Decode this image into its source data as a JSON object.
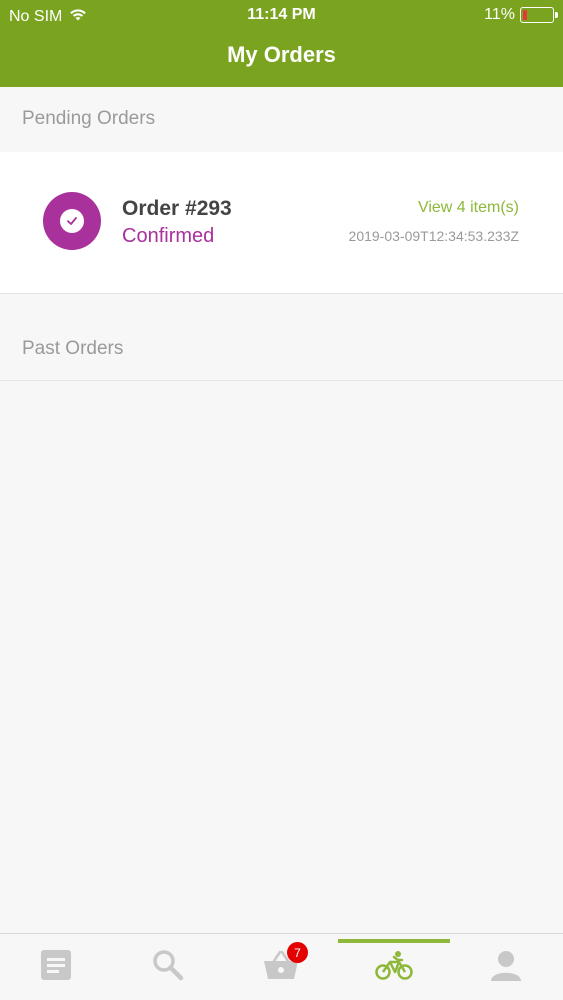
{
  "status_bar": {
    "carrier": "No SIM",
    "time": "11:14 PM",
    "battery": "11%"
  },
  "header": {
    "title": "My Orders"
  },
  "sections": {
    "pending_label": "Pending Orders",
    "past_label": "Past Orders"
  },
  "pending_orders": [
    {
      "number": "Order #293",
      "status": "Confirmed",
      "view_items": "View 4 item(s)",
      "date": "2019-03-09T12:34:53.233Z",
      "status_icon": "check-icon"
    }
  ],
  "tabbar": {
    "tabs": [
      {
        "name": "orders-list-icon"
      },
      {
        "name": "search-icon"
      },
      {
        "name": "basket-icon",
        "badge": "7"
      },
      {
        "name": "bicycle-icon",
        "active": true
      },
      {
        "name": "profile-icon"
      }
    ]
  },
  "colors": {
    "brand": "#7aa41f",
    "accent": "#8db83a",
    "status_purple": "#a9319b",
    "badge_red": "#e30000"
  }
}
